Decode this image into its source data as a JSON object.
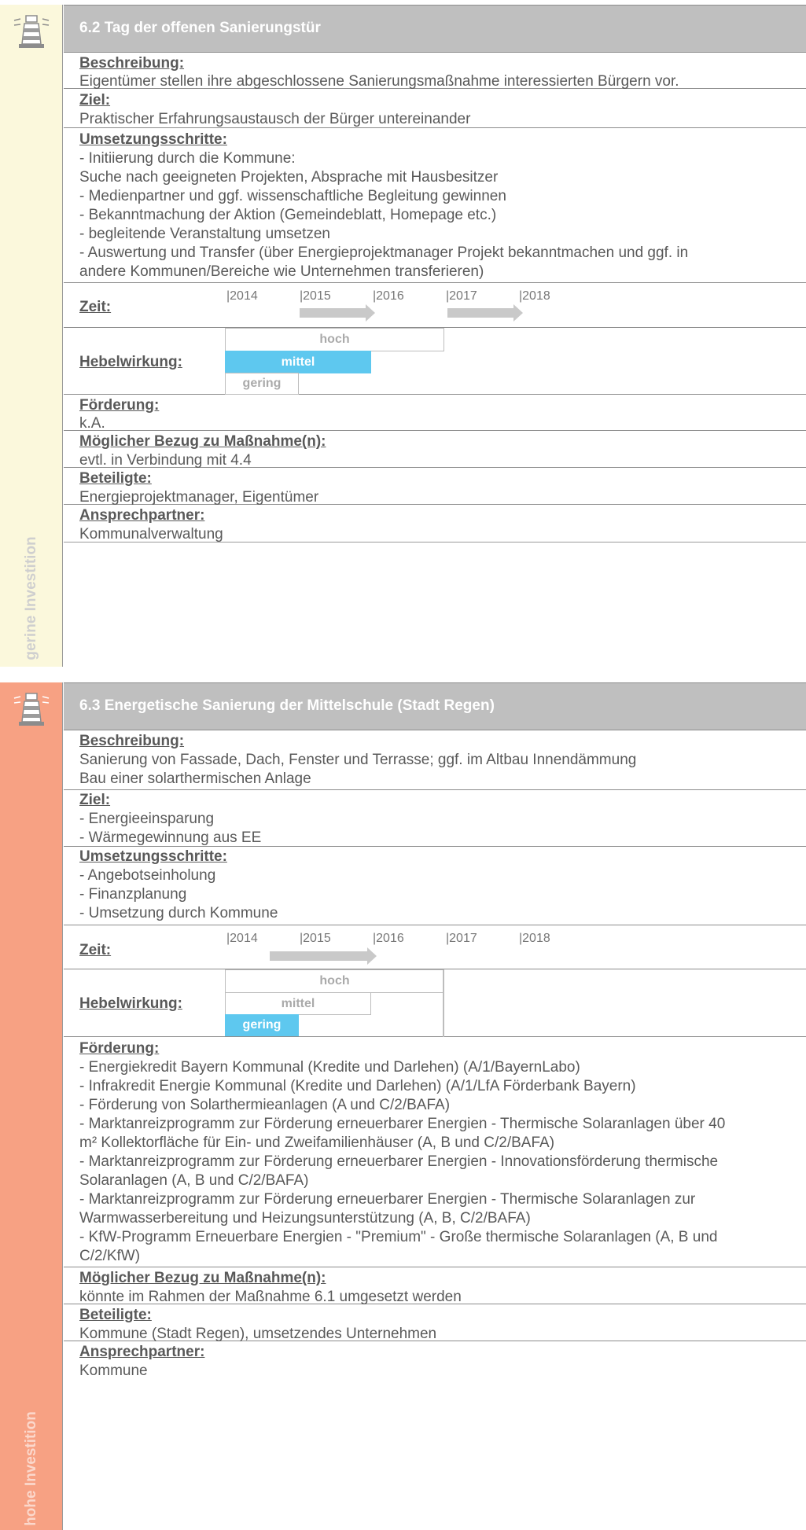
{
  "colors": {
    "low_investment_bar": "#fbf8dc",
    "high_investment_bar": "#f7a183",
    "header_bg": "#bfbfbf",
    "selected_level": "#5ec8ef",
    "timeline_arrow": "#c9c9c9"
  },
  "cards": [
    {
      "icon": "lighthouse-icon",
      "category": "gerine Investition",
      "title": "6.2 Tag der offenen Sanierungstür",
      "beschreibung": {
        "label": "Beschreibung:",
        "lines": [
          "Eigentümer stellen ihre abgeschlossene Sanierungsmaßnahme interessierten Bürgern vor."
        ]
      },
      "ziel": {
        "label": "Ziel:",
        "lines": [
          "Praktischer Erfahrungsaustausch der Bürger untereinander"
        ]
      },
      "umsetzung": {
        "label": "Umsetzungsschritte:",
        "lines": [
          "- Initiierung durch die Kommune:",
          "Suche nach geeigneten Projekten, Absprache mit Hausbesitzer",
          "- Medienpartner und ggf. wissenschaftliche Begleitung gewinnen",
          "- Bekanntmachung der Aktion (Gemeindeblatt, Homepage etc.)",
          "- begleitende Veranstaltung umsetzen",
          "- Auswertung und Transfer (über Energieprojektmanager Projekt bekanntmachen und ggf. in",
          "andere Kommunen/Bereiche wie Unternehmen transferieren)"
        ]
      },
      "zeit": {
        "label": "Zeit:",
        "years": [
          "|2014",
          "|2015",
          "|2016",
          "|2017",
          "|2018"
        ],
        "spans": [
          {
            "from": 2015,
            "to": 2016
          },
          {
            "from": 2017,
            "to": 2018
          }
        ]
      },
      "hebel": {
        "label": "Hebelwirkung:",
        "levels": [
          "hoch",
          "mittel",
          "gering"
        ],
        "selected": "mittel"
      },
      "foerderung": {
        "label": "Förderung:",
        "lines": [
          "k.A."
        ]
      },
      "bezug": {
        "label": "Möglicher Bezug zu Maßnahme(n):",
        "lines": [
          "evtl. in Verbindung mit 4.4"
        ]
      },
      "beteiligte": {
        "label": "Beteiligte:",
        "lines": [
          "Energieprojektmanager, Eigentümer"
        ]
      },
      "ansprech": {
        "label": "Ansprechpartner:",
        "lines": [
          "Kommunalverwaltung"
        ]
      }
    },
    {
      "icon": "lighthouse-icon",
      "category": "hohe Investition",
      "title": "6.3 Energetische Sanierung der Mittelschule (Stadt Regen)",
      "beschreibung": {
        "label": "Beschreibung:",
        "lines": [
          "Sanierung von Fassade, Dach, Fenster und Terrasse; ggf. im Altbau Innendämmung",
          "Bau einer solarthermischen Anlage"
        ]
      },
      "ziel": {
        "label": "Ziel:",
        "lines": [
          "- Energieeinsparung",
          "- Wärmegewinnung aus EE"
        ]
      },
      "umsetzung": {
        "label": "Umsetzungsschritte:",
        "lines": [
          "- Angebotseinholung",
          "- Finanzplanung",
          "- Umsetzung durch Kommune"
        ]
      },
      "zeit": {
        "label": "Zeit:",
        "years": [
          "|2014",
          "|2015",
          "|2016",
          "|2017",
          "|2018"
        ],
        "spans": [
          {
            "from": 2014.6,
            "to": 2016
          }
        ]
      },
      "hebel": {
        "label": "Hebelwirkung:",
        "levels": [
          "hoch",
          "mittel",
          "gering"
        ],
        "selected": "gering"
      },
      "foerderung": {
        "label": "Förderung:",
        "lines": [
          "- Energiekredit Bayern Kommunal (Kredite und Darlehen) (A/1/BayernLabo)",
          "- Infrakredit Energie Kommunal (Kredite und Darlehen) (A/1/LfA Förderbank Bayern)",
          "- Förderung von Solarthermieanlagen (A und C/2/BAFA)",
          "- Marktanreizprogramm zur Förderung erneuerbarer Energien - Thermische Solaranlagen über 40",
          "m² Kollektorfläche für Ein- und Zweifamilienhäuser (A, B und C/2/BAFA)",
          "- Marktanreizprogramm zur Förderung erneuerbarer Energien - Innovationsförderung thermische",
          "Solaranlagen (A, B und C/2/BAFA)",
          "- Marktanreizprogramm zur Förderung erneuerbarer Energien - Thermische Solaranlagen zur",
          "Warmwasserbereitung und Heizungsunterstützung (A, B, C/2/BAFA)",
          "- KfW-Programm Erneuerbare Energien - \"Premium\" - Große thermische Solaranlagen (A, B und",
          "C/2/KfW)"
        ]
      },
      "bezug": {
        "label": "Möglicher Bezug zu Maßnahme(n):",
        "lines": [
          "könnte im Rahmen der Maßnahme 6.1 umgesetzt werden"
        ]
      },
      "beteiligte": {
        "label": "Beteiligte:",
        "lines": [
          "Kommune (Stadt Regen), umsetzendes Unternehmen"
        ]
      },
      "ansprech": {
        "label": "Ansprechpartner:",
        "lines": [
          "Kommune"
        ]
      }
    }
  ]
}
